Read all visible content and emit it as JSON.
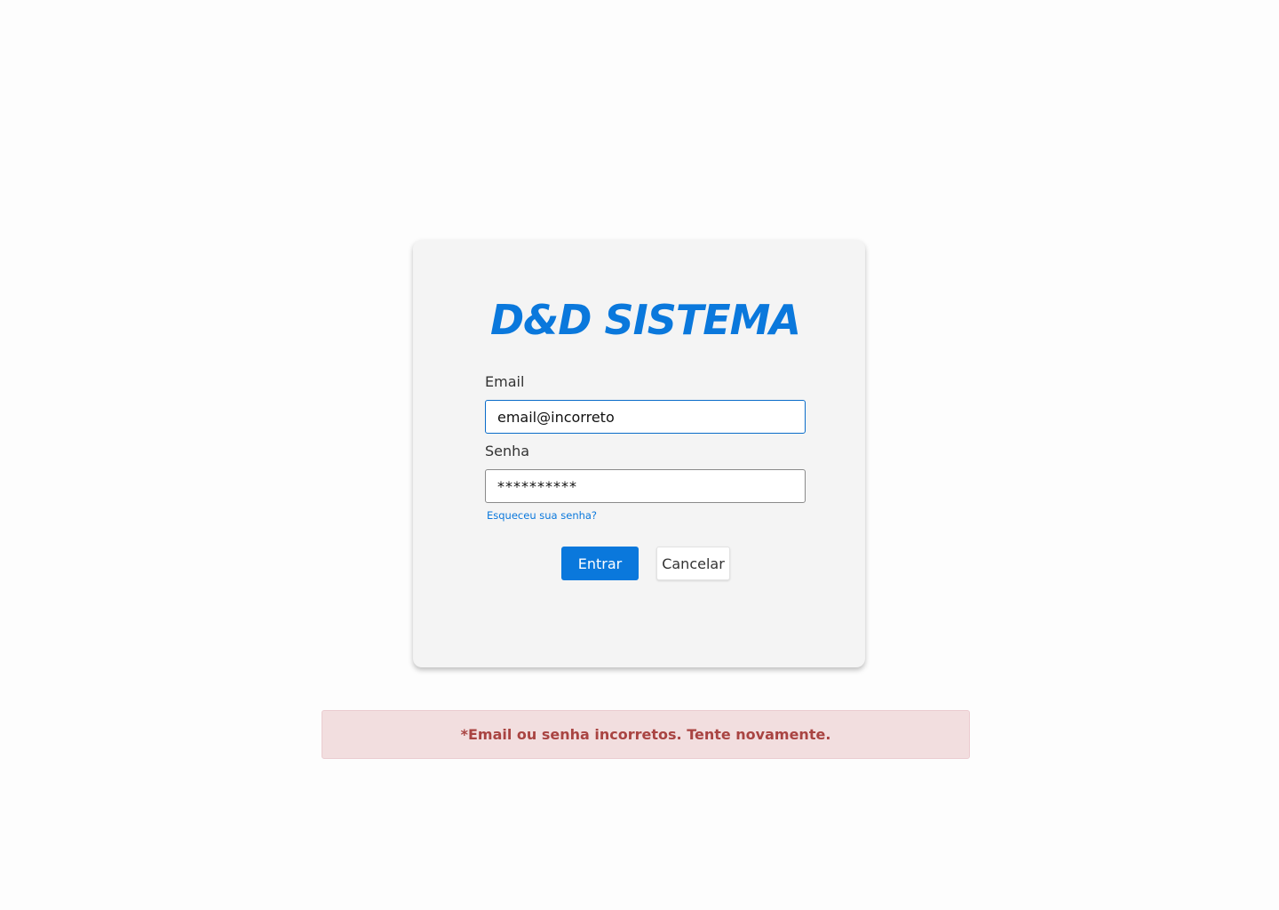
{
  "brand": {
    "title": "D&D SISTEMA"
  },
  "form": {
    "email_label": "Email",
    "email_value": "email@incorreto",
    "password_label": "Senha",
    "password_value": "**********",
    "forgot_password_link": "Esqueceu sua senha?"
  },
  "actions": {
    "submit_label": "Entrar",
    "cancel_label": "Cancelar"
  },
  "alert": {
    "message": "*Email ou senha incorretos. Tente novamente."
  },
  "colors": {
    "accent": "#0a78dc",
    "error_text": "#a94442",
    "error_background": "#f2dedf"
  }
}
